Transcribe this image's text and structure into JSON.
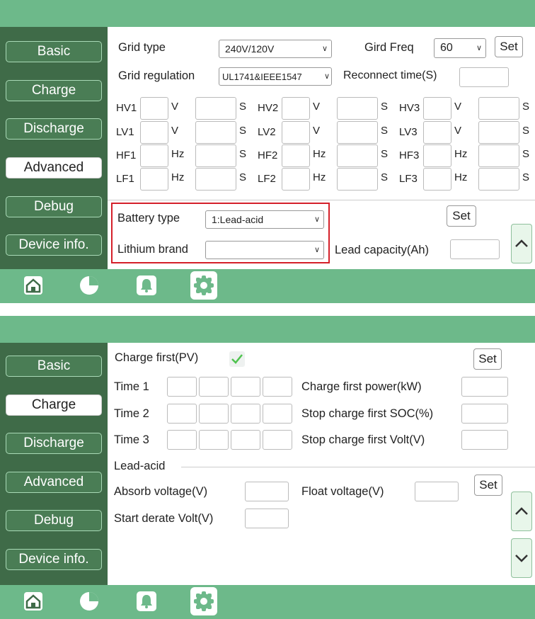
{
  "colors": {
    "header": "#6db98a",
    "sidebar": "#3f6b48",
    "nav_button": "#4a7d55",
    "highlight": "#d4202a"
  },
  "nav": [
    "Basic",
    "Charge",
    "Discharge",
    "Advanced",
    "Debug",
    "Device info."
  ],
  "bottom_icons": [
    "home-icon",
    "chart-icon",
    "bell-icon",
    "gear-icon"
  ],
  "advanced": {
    "active_nav": "Advanced",
    "grid_type_label": "Grid type",
    "grid_type_value": "240V/120V",
    "grid_freq_label": "Gird Freq",
    "grid_freq_value": "60",
    "set_label": "Set",
    "grid_regulation_label": "Grid regulation",
    "grid_regulation_value": "UL1741&IEEE1547",
    "reconnect_label": "Reconnect time(S)",
    "rows": [
      {
        "names": [
          "HV1",
          "HV2",
          "HV3"
        ],
        "unit": "V",
        "time_unit": "S"
      },
      {
        "names": [
          "LV1",
          "LV2",
          "LV3"
        ],
        "unit": "V",
        "time_unit": "S"
      },
      {
        "names": [
          "HF1",
          "HF2",
          "HF3"
        ],
        "unit": "Hz",
        "time_unit": "S"
      },
      {
        "names": [
          "LF1",
          "LF2",
          "LF3"
        ],
        "unit": "Hz",
        "time_unit": "S"
      }
    ],
    "battery_type_label": "Battery type",
    "battery_type_value": "1:Lead-acid",
    "lithium_brand_label": "Lithium brand",
    "lithium_brand_value": "",
    "lead_capacity_label": "Lead capacity(Ah)",
    "set2_label": "Set"
  },
  "charge": {
    "active_nav": "Charge",
    "charge_first_label": "Charge first(PV)",
    "charge_first_checked": true,
    "set_label": "Set",
    "time_labels": [
      "Time 1",
      "Time 2",
      "Time 3"
    ],
    "right_labels": [
      "Charge first power(kW)",
      "Stop charge first SOC(%)",
      "Stop charge first Volt(V)"
    ],
    "section_label": "Lead-acid",
    "absorb_label": "Absorb voltage(V)",
    "float_label": "Float voltage(V)",
    "start_derate_label": "Start derate Volt(V)",
    "set2_label": "Set"
  }
}
